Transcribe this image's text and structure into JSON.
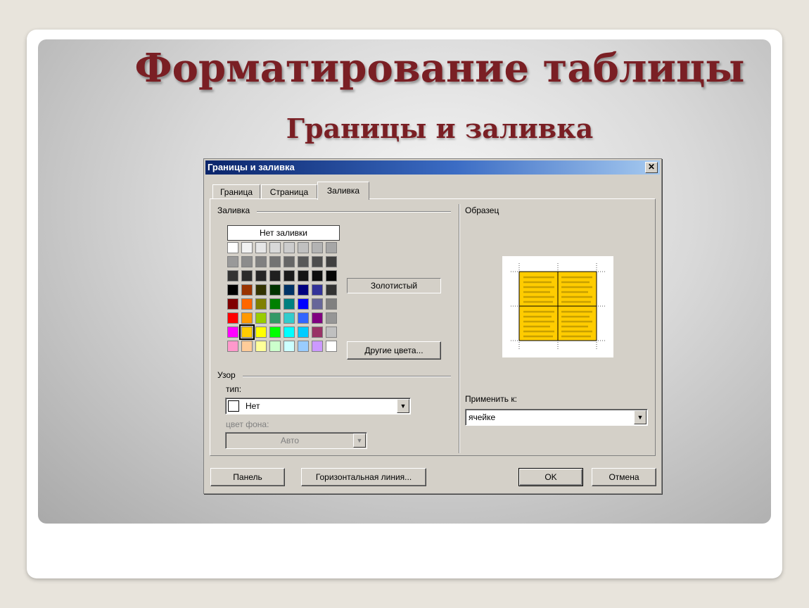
{
  "slide": {
    "title": "Форматирование таблицы",
    "subtitle": "Границы и заливка"
  },
  "dialog": {
    "title": "Границы и заливка",
    "close_label": "✕",
    "tabs": [
      {
        "label": "Граница",
        "active": false
      },
      {
        "label": "Страница",
        "active": false
      },
      {
        "label": "Заливка",
        "active": true
      }
    ],
    "fill": {
      "group_label": "Заливка",
      "no_fill_label": "Нет заливки",
      "selected_color_name": "Золотистый",
      "more_colors_label": "Другие цвета...",
      "palette": [
        [
          "#ffffff",
          "#f2f2f2",
          "#e6e6e6",
          "#d9d9d9",
          "#cccccc",
          "#c0c0c0",
          "#b3b3b3",
          "#a6a6a6"
        ],
        [
          "#999999",
          "#8c8c8c",
          "#808080",
          "#737373",
          "#666666",
          "#595959",
          "#4d4d4d",
          "#404040"
        ],
        [
          "#333333",
          "#2b2b2b",
          "#262626",
          "#202020",
          "#1a1a1a",
          "#141414",
          "#0d0d0d",
          "#050505"
        ],
        [
          "#000000",
          "#993300",
          "#333300",
          "#003300",
          "#003366",
          "#000080",
          "#333399",
          "#333333"
        ],
        [
          "#800000",
          "#ff6600",
          "#808000",
          "#008000",
          "#008080",
          "#0000ff",
          "#666699",
          "#808080"
        ],
        [
          "#ff0000",
          "#ff9900",
          "#99cc00",
          "#339966",
          "#33cccc",
          "#3366ff",
          "#800080",
          "#969696"
        ],
        [
          "#ff00ff",
          "#ffcc00",
          "#ffff00",
          "#00ff00",
          "#00ffff",
          "#00ccff",
          "#993366",
          "#c0c0c0"
        ],
        [
          "#ff99cc",
          "#ffcc99",
          "#ffff99",
          "#ccffcc",
          "#ccffff",
          "#99ccff",
          "#cc99ff",
          "#ffffff"
        ]
      ],
      "selected_swatch": [
        6,
        1
      ],
      "accent_color": "#ffcc00"
    },
    "pattern": {
      "group_label": "Узор",
      "type_label": "тип:",
      "type_value": "Нет",
      "bg_label": "цвет фона:",
      "bg_value": "Авто"
    },
    "preview": {
      "group_label": "Образец",
      "apply_label": "Применить к:",
      "apply_value": "ячейке"
    },
    "buttons": {
      "panel": "Панель",
      "horizontal_line": "Горизонтальная линия...",
      "ok": "OK",
      "cancel": "Отмена"
    }
  }
}
